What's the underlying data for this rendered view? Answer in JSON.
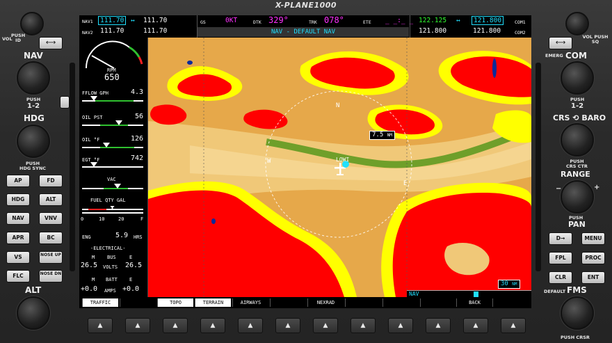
{
  "brand": "X-PLANE1000",
  "topbar": {
    "nav1_label": "NAV1",
    "nav1_active": "111.70",
    "nav1_standby": "111.70",
    "nav2_label": "NAV2",
    "nav2_active": "111.70",
    "nav2_standby": "111.70",
    "swap_glyph": "↔",
    "gs_label": "GS",
    "gs_value": "0KT",
    "dtk_label": "DTK",
    "dtk_value": "329°",
    "trk_label": "TRK",
    "trk_value": "078°",
    "ete_label": "ETE",
    "ete_value": "_ _:_ _",
    "com1_active": "122.125",
    "com1_standby": "121.800",
    "com1_label": "COM1",
    "com2_active": "121.800",
    "com2_standby": "121.800",
    "com2_label": "COM2",
    "nav_banner": "NAV - DEFAULT NAV"
  },
  "eis": {
    "rpm_label": "RPM",
    "rpm_value": "650",
    "fflow_label": "FFLOW GPH",
    "fflow_value": "4.3",
    "oil_pst_label": "OIL PST",
    "oil_pst_value": "56",
    "oil_temp_label": "OIL °F",
    "oil_temp_value": "126",
    "egt_label": "EGT °F",
    "egt_value": "742",
    "vac_label": "VAC",
    "fuel_label": "FUEL QTY GAL",
    "fuel_ticks": [
      "0",
      "10",
      "20",
      "F"
    ],
    "eng_label": "ENG",
    "eng_value": "5.9",
    "eng_unit": "HRS",
    "electrical_label": "-ELECTRICAL-",
    "bus_m": "M",
    "bus_label": "BUS",
    "bus_e": "E",
    "volts_m": "26.5",
    "volts_label": "VOLTS",
    "volts_e": "26.5",
    "batt_m": "M",
    "batt_label": "BATT",
    "batt_e": "E",
    "amps_m": "+0.0",
    "amps_label": "AMPS",
    "amps_e": "+0.0"
  },
  "map": {
    "range_label": "7.5",
    "range_unit": "NM",
    "map_scale": "30",
    "map_scale_unit": "NM",
    "airport": "LOWI",
    "compass": {
      "n": "N",
      "e": "E",
      "w": "W"
    },
    "inset_label": "NAV"
  },
  "softkeys": [
    "TRAFFIC",
    "",
    "TOPO",
    "TERRAIN",
    "AIRWAYS",
    "",
    "NEXRAD",
    "",
    "",
    "",
    "BACK",
    ""
  ],
  "left_panel": {
    "vol_label": "VOL",
    "push_id_label": "PUSH\nID",
    "nav_label": "NAV",
    "push_12": "PUSH\n1-2",
    "hdg_label": "HDG",
    "push_hdg_sync": "PUSH\nHDG SYNC",
    "alt_label": "ALT",
    "buttons": [
      [
        "AP",
        "FD"
      ],
      [
        "HDG",
        "ALT"
      ],
      [
        "NAV",
        "VNV"
      ],
      [
        "APR",
        "BC"
      ],
      [
        "VS",
        "NOSE UP"
      ],
      [
        "FLC",
        "NOSE DN"
      ]
    ]
  },
  "right_panel": {
    "vol_sq_label": "VOL PUSH SQ",
    "emerg_label": "EMERG",
    "com_label": "COM",
    "push_12": "PUSH\n1-2",
    "crs_baro_label": "CRS ⟲ BARO",
    "push_crs_ctr": "PUSH\nCRS CTR",
    "range_label": "RANGE",
    "push_pan": "PUSH",
    "pan_label": "PAN",
    "buttons": [
      [
        "D→",
        "MENU"
      ],
      [
        "FPL",
        "PROC"
      ],
      [
        "CLR",
        "ENT"
      ]
    ],
    "default_label": "DEFAULT",
    "fms_label": "FMS",
    "push_crsr": "PUSH CRSR"
  },
  "colors": {
    "terrain_red": "#ff0000",
    "terrain_yellow": "#ffff00",
    "terrain_tan": "#e6a84a",
    "route_green": "#6f9f2a",
    "cyan": "#20e0ff",
    "magenta": "#ff30ff"
  }
}
